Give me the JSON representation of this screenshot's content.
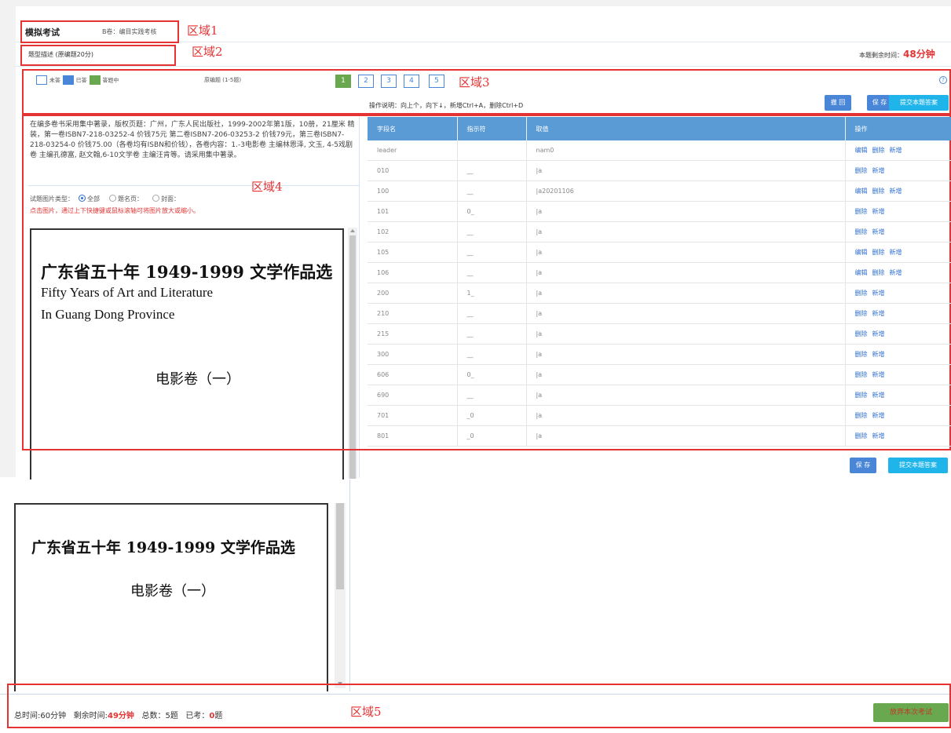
{
  "header": {
    "title": "模拟考试",
    "subtitle": "B卷：编目实践考核",
    "question_type": "题型描述 (原编题20分)",
    "remaining_label": "本题剩余时间：",
    "remaining_value": "48分钟"
  },
  "zones": {
    "z1": "区域1",
    "z2": "区域2",
    "z3": "区域3",
    "z4": "区域4",
    "z5": "区域5"
  },
  "legend": {
    "unanswered": "未答",
    "answered": "已答",
    "answering": "答题中",
    "range": "原编题 (1-5题)"
  },
  "pages": [
    "1",
    "2",
    "3",
    "4",
    "5"
  ],
  "help_icon": "?",
  "instructions": "操作说明：向上个，向下↓，新增Ctrl+A，删除Ctrl+D",
  "buttons": {
    "back": "撤 回",
    "save": "保 存",
    "submit": "提交本题答案",
    "save2": "保 存",
    "submit2": "提交本题答案",
    "abandon": "放弃本次考试"
  },
  "question_text": "在编多卷书采用集中著录，版权页题：广州，广东人民出版社，1999-2002年第1版，10册，21厘米 精装，第一卷ISBN7-218-03252-4 价钱75元 第二卷ISBN7-206-03253-2 价钱79元，第三卷ISBN7-218-03254-0 价钱75.00（各卷均有ISBN和价钱），各卷内容：1.-3电影卷 主编林恩泽, 文玉, 4-5戏剧卷 主编孔德富, 赵文翰,6-10文学卷 主编汪肯等。请采用集中著录。",
  "image_type": {
    "label": "试题图片类型：",
    "options": [
      "全部",
      "题名页：",
      "封面："
    ]
  },
  "hint": "点击图片，通过上下快捷键或鼠标滚轴可将图片放大或缩小。",
  "book": {
    "title_cn": "广东省五十年 1949-1999 文学作品选",
    "title_en1": "Fifty Years of Art and Literature",
    "title_en2": "In Guang Dong Province",
    "volume": "电影卷（一）"
  },
  "table": {
    "headers": [
      "字段名",
      "指示符",
      "取值",
      "操作"
    ],
    "rows": [
      {
        "field": "leader",
        "ind": "",
        "value": "nam0",
        "ops": [
          "编辑",
          "删除",
          "新增"
        ]
      },
      {
        "field": "010",
        "ind": "__",
        "value": "|a",
        "ops": [
          "删除",
          "新增"
        ]
      },
      {
        "field": "100",
        "ind": "__",
        "value": "|a20201106",
        "ops": [
          "编辑",
          "删除",
          "新增"
        ]
      },
      {
        "field": "101",
        "ind": "0_",
        "value": "|a",
        "ops": [
          "删除",
          "新增"
        ]
      },
      {
        "field": "102",
        "ind": "__",
        "value": "|a",
        "ops": [
          "删除",
          "新增"
        ]
      },
      {
        "field": "105",
        "ind": "__",
        "value": "|a",
        "ops": [
          "编辑",
          "删除",
          "新增"
        ]
      },
      {
        "field": "106",
        "ind": "__",
        "value": "|a",
        "ops": [
          "编辑",
          "删除",
          "新增"
        ]
      },
      {
        "field": "200",
        "ind": "1_",
        "value": "|a",
        "ops": [
          "删除",
          "新增"
        ]
      },
      {
        "field": "210",
        "ind": "__",
        "value": "|a",
        "ops": [
          "删除",
          "新增"
        ]
      },
      {
        "field": "215",
        "ind": "__",
        "value": "|a",
        "ops": [
          "删除",
          "新增"
        ]
      },
      {
        "field": "300",
        "ind": "__",
        "value": "|a",
        "ops": [
          "删除",
          "新增"
        ]
      },
      {
        "field": "606",
        "ind": "0_",
        "value": "|a",
        "ops": [
          "删除",
          "新增"
        ]
      },
      {
        "field": "690",
        "ind": "__",
        "value": "|a",
        "ops": [
          "删除",
          "新增"
        ]
      },
      {
        "field": "701",
        "ind": "_0",
        "value": "|a",
        "ops": [
          "删除",
          "新增"
        ]
      },
      {
        "field": "801",
        "ind": "_0",
        "value": "|a",
        "ops": [
          "删除",
          "新增"
        ]
      }
    ]
  },
  "footer": {
    "total_label": "总时间:60分钟",
    "remaining_label": "剩余时间:",
    "remaining_value": "49分钟",
    "count_label": "总数：5题",
    "done_label": "已考：",
    "done_value": "0",
    "done_unit": "题"
  },
  "colors": {
    "accent_blue": "#4a86d8",
    "accent_cyan": "#1fb4ea",
    "green": "#6aa84f",
    "red": "#e53333",
    "header_blue": "#5b9bd5"
  }
}
